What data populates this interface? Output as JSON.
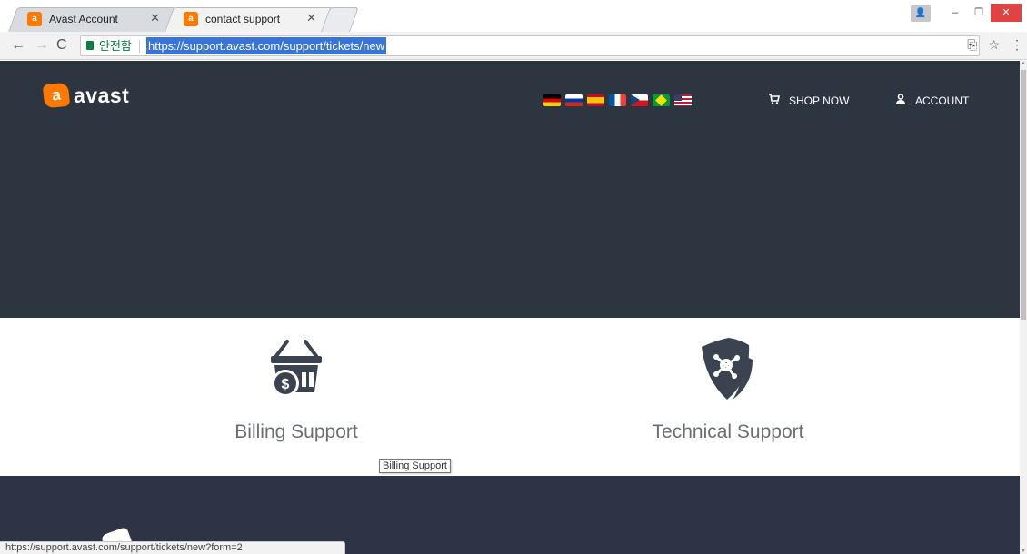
{
  "browser": {
    "tabs": [
      {
        "title": "Avast Account",
        "favicon": "avast-icon",
        "active": false
      },
      {
        "title": "contact support",
        "favicon": "avast-icon",
        "active": true
      }
    ],
    "omnibox": {
      "security_label": "안전함",
      "url": "https://support.avast.com/support/tickets/new"
    },
    "status_url": "https://support.avast.com/support/tickets/new?form=2"
  },
  "header": {
    "logo_text": "avast",
    "logo_mark": "a",
    "languages": [
      "de",
      "ru",
      "es",
      "fr",
      "cz",
      "br",
      "us"
    ],
    "shop_now": "SHOP NOW",
    "account": "ACCOUNT"
  },
  "options": {
    "billing": {
      "label": "Billing Support",
      "icon": "billing-basket-icon"
    },
    "technical": {
      "label": "Technical Support",
      "icon": "shield-icon"
    }
  },
  "tooltip": "Billing Support",
  "colors": {
    "hero_bg": "#2d3540",
    "footer_bg": "#2c3445",
    "brand_orange": "#ff7800",
    "icon_dark": "#3c4350"
  }
}
